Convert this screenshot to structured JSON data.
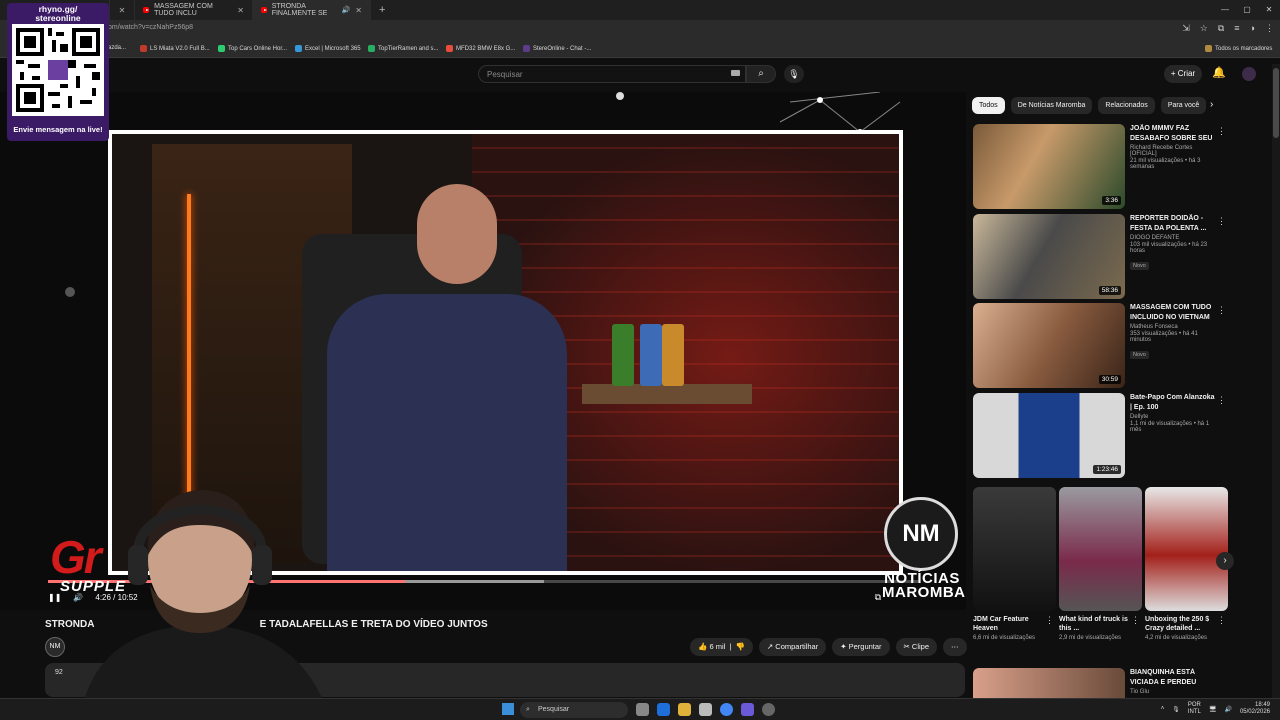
{
  "browser": {
    "tabs": [
      {
        "title": ""
      },
      {
        "title": "MASSAGEM COM TUDO INCLU"
      },
      {
        "title": "STRONDA FINALMENTE SE"
      }
    ],
    "url": "om/watch?v=czNahPz56p8",
    "bookmarks": [
      "azda...",
      "LS Miata V2.0 Full B...",
      "Top Cars Online Hor...",
      "Excel | Microsoft 365",
      "TopTierRamen and s...",
      "MFD32 BMW E8x G...",
      "StereOnline - Chat -...",
      "Todos os marcadores"
    ]
  },
  "youtube": {
    "search_placeholder": "Pesquisar",
    "create_label": "Criar",
    "video": {
      "title": "STRONDA",
      "title_rest": "E TADALAFELLAS E TRETA DO VÍDEO JUNTOS",
      "time": "4:26 / 10:52",
      "progress": 0.41,
      "channel_overlay": "NOTÍCIAS\nMAROMBA",
      "channel_initials": "NM",
      "actions": {
        "likes": "6 mil",
        "share": "Compartilhar",
        "ask": "Perguntar",
        "clip": "Clipe"
      },
      "desc_preview": "92"
    },
    "chips": [
      "Todos",
      "De Notícias Maromba",
      "Relacionados",
      "Para você"
    ],
    "recommendations": [
      {
        "title": "JOÃO MMMV FAZ DESABAFO SOBRE SEU ...",
        "channel": "Richard Recebe Cortes [OFICIAL]",
        "views": "21 mil visualizações • há 3 semanas",
        "badge": "",
        "duration": "3:36"
      },
      {
        "title": "REPÓRTER DOIDÃO - FESTA DA POLENTA ...",
        "channel": "DIOGO DEFANTE",
        "views": "103 mil visualizações • há 23 horas",
        "badge": "Novo",
        "duration": "58:36"
      },
      {
        "title": "MASSAGEM COM TUDO INCLUIDO NO VIETNAM",
        "channel": "Matheus Fonseca",
        "views": "353 visualizações • há 41 minutos",
        "badge": "Novo",
        "duration": "30:59"
      },
      {
        "title": "Bate-Papo Com Alanzoka | Ep. 100",
        "channel": "Dellyte",
        "views": "1,1 mi de visualizações • há 1 mês",
        "badge": "",
        "duration": "1:23:46"
      }
    ],
    "shorts": [
      {
        "title": "JDM Car Feature Heaven",
        "views": "6,6 mi de visualizações"
      },
      {
        "title": "What kind of truck is this ...",
        "views": "2,9 mi de visualizações"
      },
      {
        "title": "Unboxing the 250 $ Crazy detailed ...",
        "views": "4,2 mi de visualizações"
      }
    ],
    "last_rec": {
      "title": "BIANQUINHA ESTÁ VICIADA E PERDEU TUDO...",
      "channel": "Tio Glu"
    }
  },
  "overlay": {
    "qr_title": "rhyno.gg/\nstereonline",
    "qr_cta": "Envie mensagem na live!",
    "sponsor_main": "Gr",
    "sponsor_sub": "SUPPLE"
  },
  "taskbar": {
    "search": "Pesquisar",
    "lang": "POR\nINTL",
    "time": "18:49",
    "date": "05/02/2026"
  },
  "colors": {
    "accent": "#ff0000",
    "qr_panel": "#3b1a66"
  }
}
